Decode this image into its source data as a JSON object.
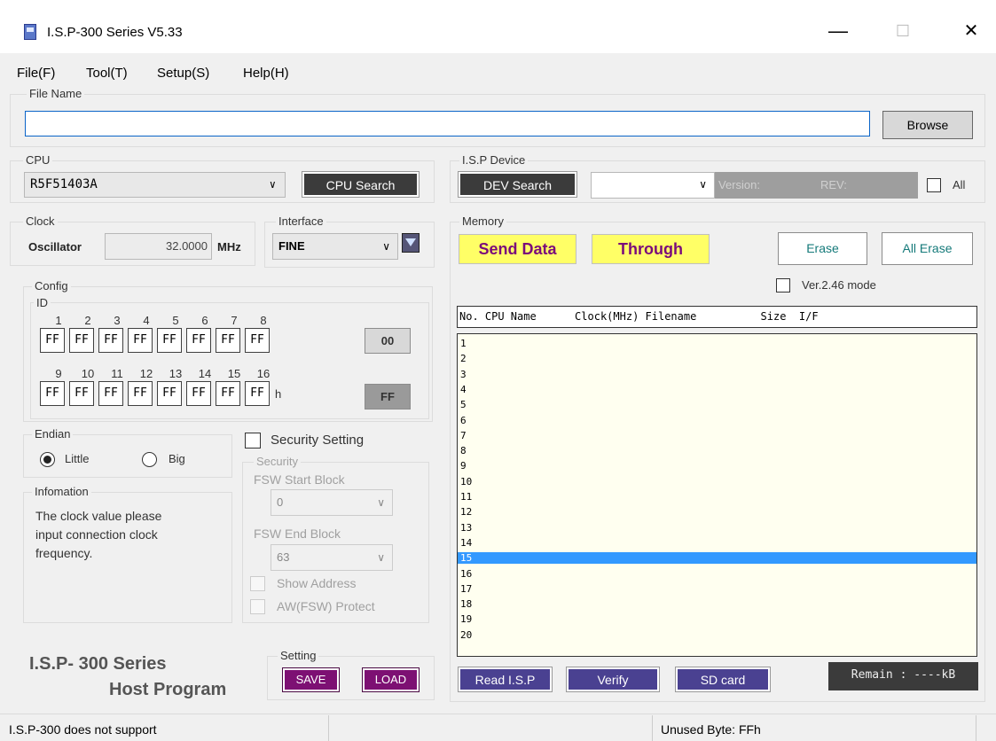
{
  "window": {
    "title": "I.S.P-300 Series V5.33",
    "minimize_glyph": "—",
    "maximize_glyph": "☐",
    "close_glyph": "✕"
  },
  "menu": [
    "File(F)",
    "Tool(T)",
    "Setup(S)",
    "Help(H)"
  ],
  "file_name": {
    "group_label": "File Name",
    "value": "",
    "browse": "Browse"
  },
  "cpu": {
    "group_label": "CPU",
    "selected": "R5F51403A",
    "search": "CPU Search"
  },
  "isp_device": {
    "group_label": "I.S.P Device",
    "search": "DEV Search",
    "selected": "",
    "version_label": "Version:",
    "rev_label": "REV:",
    "all_label": "All"
  },
  "clock": {
    "group_label": "Clock",
    "oscillator_label": "Oscillator",
    "value": "32.0000",
    "unit": "MHz"
  },
  "interface": {
    "group_label": "Interface",
    "selected": "FINE"
  },
  "memory": {
    "group_label": "Memory",
    "send_data": "Send Data",
    "through": "Through",
    "erase": "Erase",
    "all_erase": "All Erase",
    "ver_mode": "Ver.2.46 mode",
    "header": "No. CPU Name      Clock(MHz) Filename          Size  I/F",
    "rows": [
      "1",
      "2",
      "3",
      "4",
      "5",
      "6",
      "7",
      "8",
      "9",
      "10",
      "11",
      "12",
      "13",
      "14",
      "15",
      "16",
      "17",
      "18",
      "19",
      "20"
    ],
    "selected_row": "15"
  },
  "config": {
    "group_label": "Config",
    "id_label": "ID",
    "id_numbers_row1": [
      "1",
      "2",
      "3",
      "4",
      "5",
      "6",
      "7",
      "8"
    ],
    "id_values_row1": [
      "FF",
      "FF",
      "FF",
      "FF",
      "FF",
      "FF",
      "FF",
      "FF"
    ],
    "id_numbers_row2": [
      "9",
      "10",
      "11",
      "12",
      "13",
      "14",
      "15",
      "16"
    ],
    "id_values_row2": [
      "FF",
      "FF",
      "FF",
      "FF",
      "FF",
      "FF",
      "FF",
      "FF"
    ],
    "h_suffix": "h",
    "btn_00": "00",
    "btn_ff": "FF"
  },
  "endian": {
    "group_label": "Endian",
    "little": "Little",
    "big": "Big",
    "selected": "Little"
  },
  "security": {
    "setting_label": "Security Setting",
    "group_label": "Security",
    "start_label": "FSW Start Block",
    "start_value": "0",
    "end_label": "FSW End Block",
    "end_value": "63",
    "show_address": "Show Address",
    "aw_protect": "AW(FSW) Protect"
  },
  "info": {
    "group_label": "Infomation",
    "text_lines": [
      "The clock value please",
      "input connection clock",
      "frequency."
    ]
  },
  "branding": {
    "line1": "I.S.P- 300  Series",
    "line2": "Host Program"
  },
  "setting": {
    "group_label": "Setting",
    "save": "SAVE",
    "load": "LOAD"
  },
  "bottom_buttons": {
    "read_isp": "Read I.S.P",
    "verify": "Verify",
    "sd_card": "SD card",
    "remain": "Remain : ----kB"
  },
  "status": {
    "left": "I.S.P-300 does not support",
    "middle": "",
    "right": "Unused Byte: FFh"
  },
  "colors": {
    "selection": "#3399ff",
    "list_bg": "#fffff0",
    "yellow_btn": "#ffff66",
    "purple_btn": "#7d1073",
    "blue_btn": "#4a4191"
  }
}
